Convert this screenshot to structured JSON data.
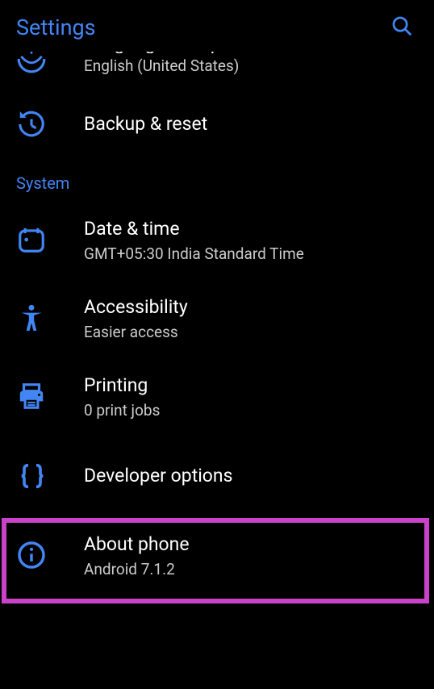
{
  "header": {
    "title": "Settings"
  },
  "partial": {
    "title_fragment": "Languages & input",
    "subtitle": "English (United States)"
  },
  "backup": {
    "title": "Backup & reset"
  },
  "section": "System",
  "datetime": {
    "title": "Date & time",
    "subtitle": "GMT+05:30 India Standard Time"
  },
  "accessibility": {
    "title": "Accessibility",
    "subtitle": "Easier access"
  },
  "printing": {
    "title": "Printing",
    "subtitle": "0 print jobs"
  },
  "devops": {
    "title": "Developer options"
  },
  "about": {
    "title": "About phone",
    "subtitle": "Android 7.1.2"
  }
}
